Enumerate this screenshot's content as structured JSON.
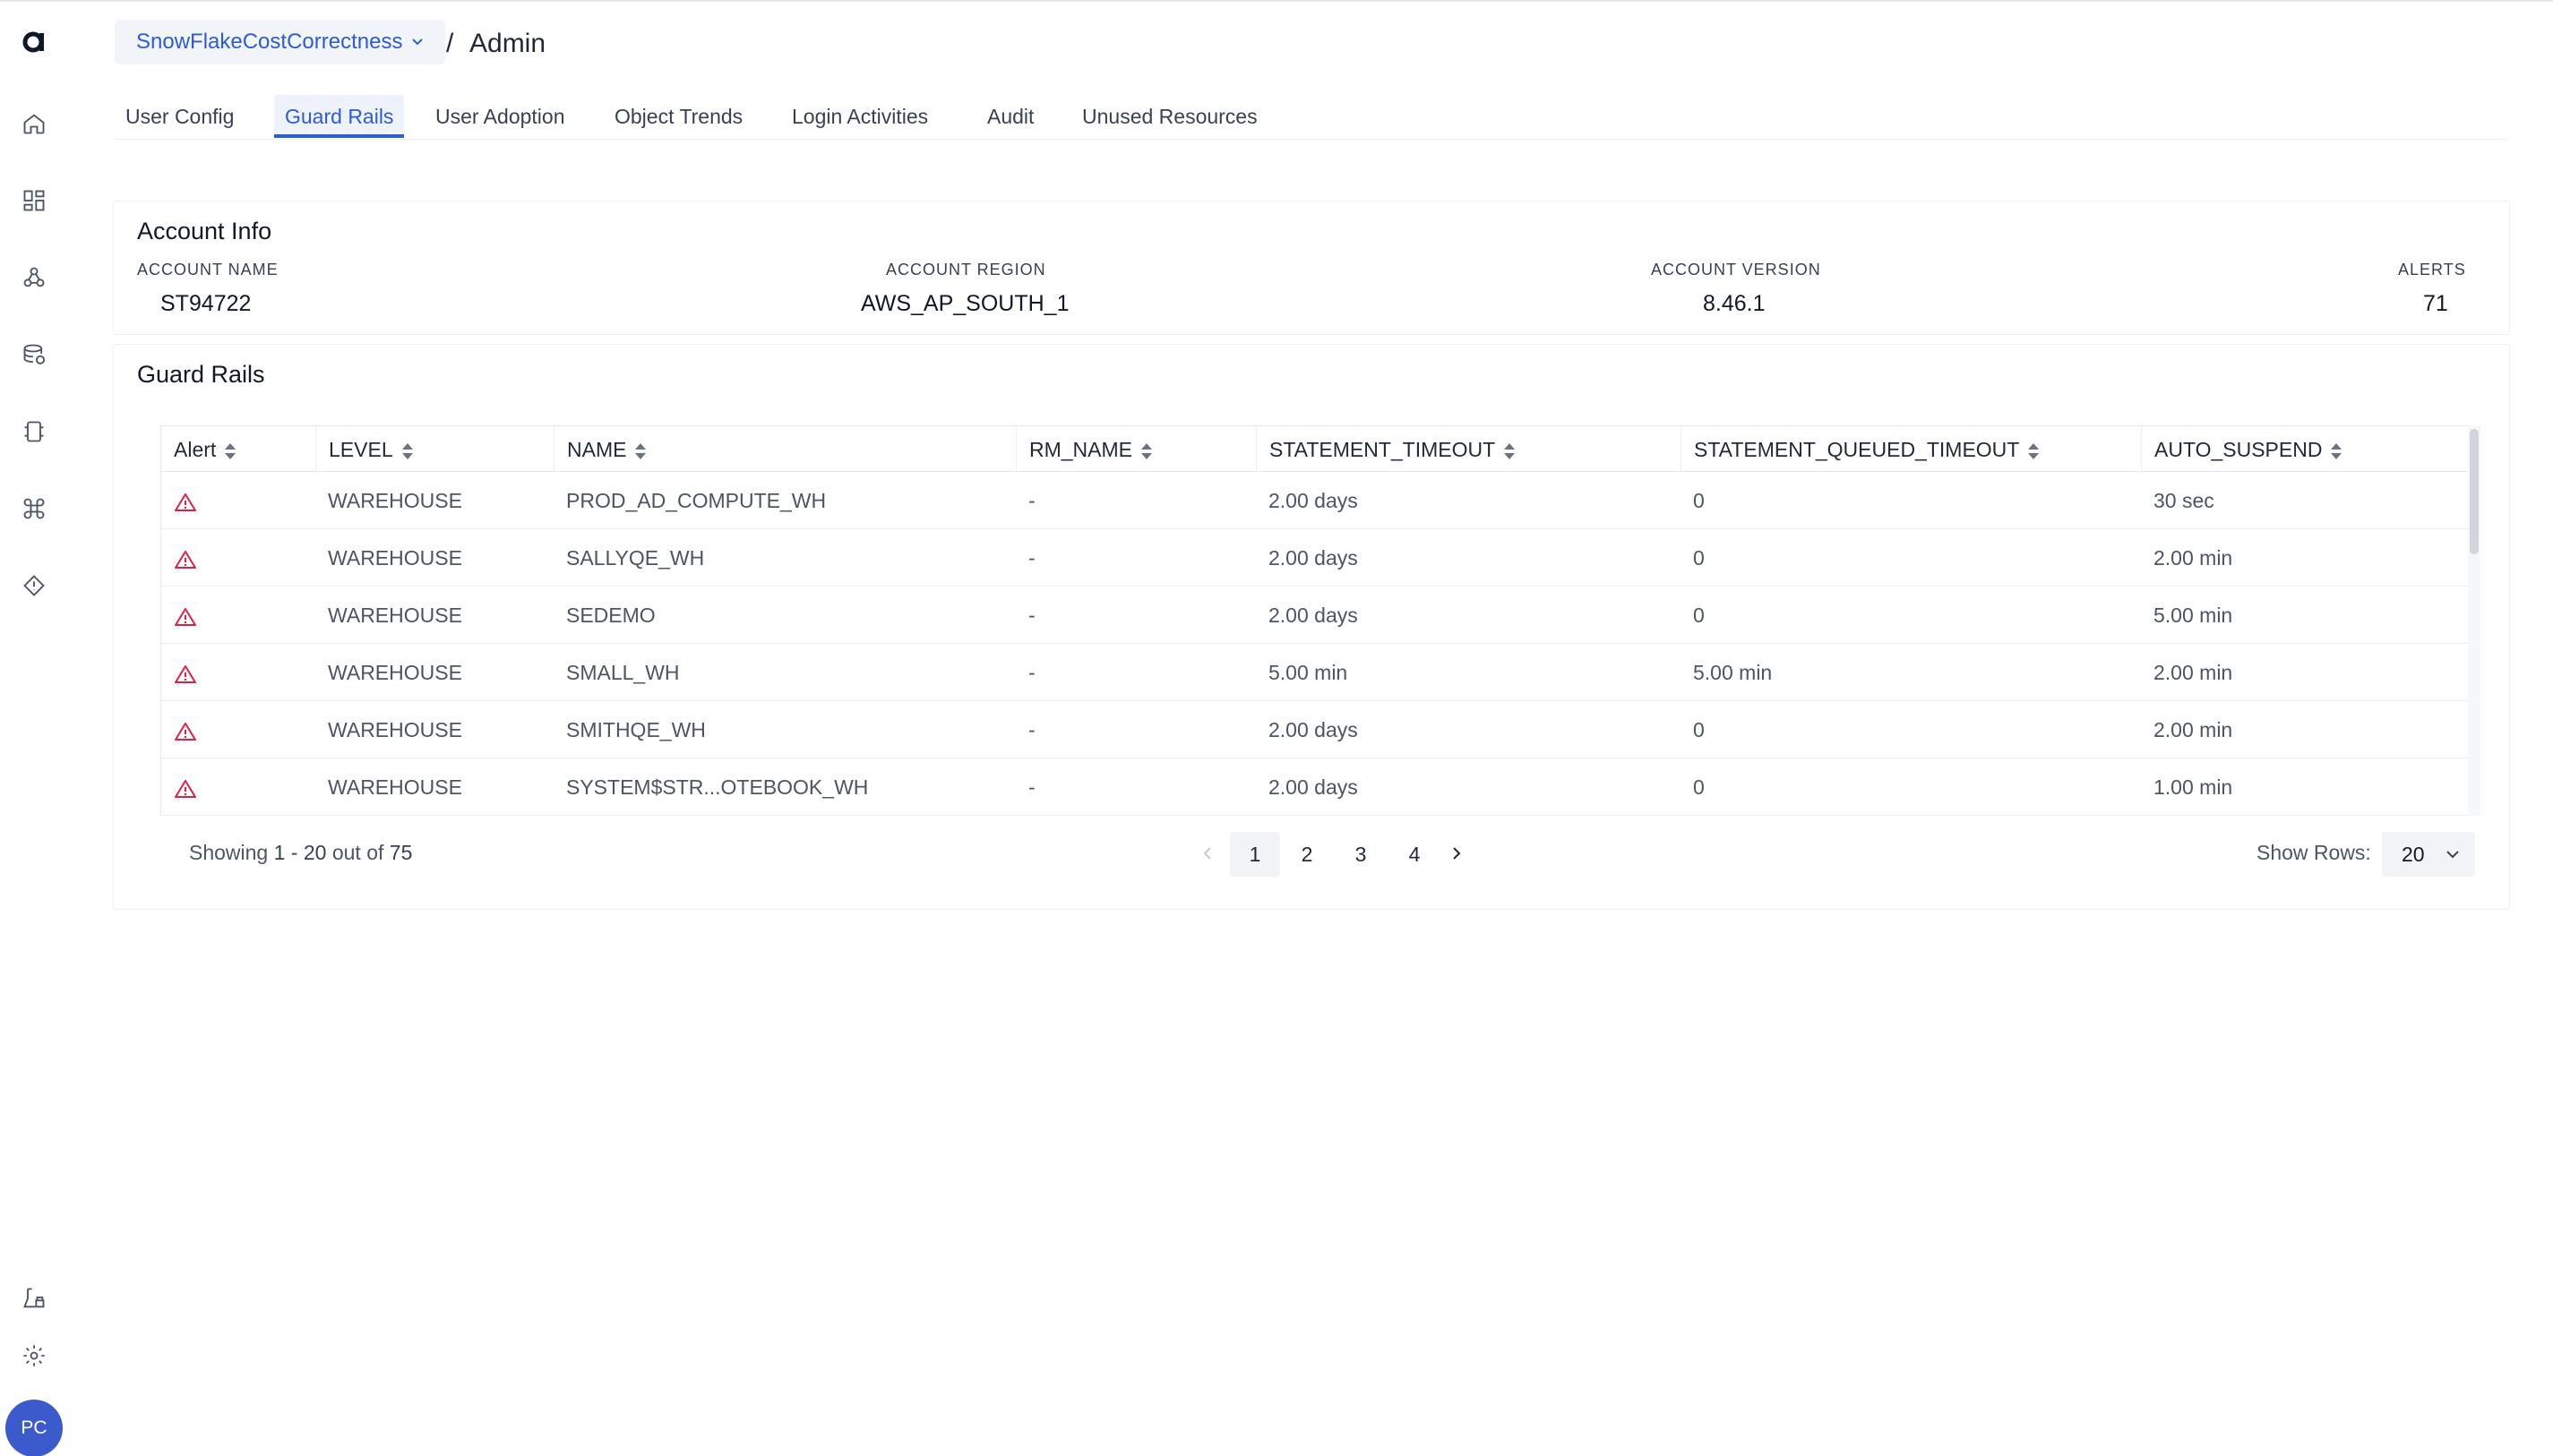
{
  "header": {
    "project": "SnowFlakeCostCorrectness",
    "separator": "/",
    "title": "Admin"
  },
  "tabs": [
    {
      "label": "User Config"
    },
    {
      "label": "Guard Rails",
      "active": true
    },
    {
      "label": "User Adoption"
    },
    {
      "label": "Object Trends"
    },
    {
      "label": "Login Activities"
    },
    {
      "label": "Audit"
    },
    {
      "label": "Unused Resources"
    }
  ],
  "account_info": {
    "title": "Account Info",
    "fields": [
      {
        "label": "ACCOUNT NAME",
        "value": "ST94722"
      },
      {
        "label": "ACCOUNT REGION",
        "value": "AWS_AP_SOUTH_1"
      },
      {
        "label": "ACCOUNT VERSION",
        "value": "8.46.1"
      },
      {
        "label": "ALERTS",
        "value": "71"
      }
    ]
  },
  "guard_rails": {
    "title": "Guard Rails",
    "columns": [
      "Alert",
      "LEVEL",
      "NAME",
      "RM_NAME",
      "STATEMENT_TIMEOUT",
      "STATEMENT_QUEUED_TIMEOUT",
      "AUTO_SUSPEND"
    ],
    "rows": [
      {
        "level": "WAREHOUSE",
        "name": "PROD_AD_COMPUTE_WH",
        "rm_name": "-",
        "statement_timeout": "2.00 days",
        "queued_timeout": "0",
        "auto_suspend": "30 sec"
      },
      {
        "level": "WAREHOUSE",
        "name": "SALLYQE_WH",
        "rm_name": "-",
        "statement_timeout": "2.00 days",
        "queued_timeout": "0",
        "auto_suspend": "2.00 min"
      },
      {
        "level": "WAREHOUSE",
        "name": "SEDEMO",
        "rm_name": "-",
        "statement_timeout": "2.00 days",
        "queued_timeout": "0",
        "auto_suspend": "5.00 min"
      },
      {
        "level": "WAREHOUSE",
        "name": "SMALL_WH",
        "rm_name": "-",
        "statement_timeout": "5.00 min",
        "queued_timeout": "5.00 min",
        "auto_suspend": "2.00 min"
      },
      {
        "level": "WAREHOUSE",
        "name": "SMITHQE_WH",
        "rm_name": "-",
        "statement_timeout": "2.00 days",
        "queued_timeout": "0",
        "auto_suspend": "2.00 min"
      },
      {
        "level": "WAREHOUSE",
        "name": "SYSTEM$STR...OTEBOOK_WH",
        "rm_name": "-",
        "statement_timeout": "2.00 days",
        "queued_timeout": "0",
        "auto_suspend": "1.00 min"
      }
    ],
    "alert_icon": "warning-triangle-icon",
    "alert_color": "#e11d48"
  },
  "pagination": {
    "showing_prefix": "Showing",
    "range": "1 - 20",
    "out_of": "out of",
    "total": "75",
    "pages": [
      "1",
      "2",
      "3",
      "4"
    ],
    "current_page": "1",
    "show_rows_label": "Show Rows:",
    "rows_per_page": "20"
  },
  "sidebar": {
    "icons": [
      "home-icon",
      "dashboard-icon",
      "cluster-icon",
      "database-icon",
      "chip-icon",
      "command-icon",
      "diamond-icon",
      "lab-icon",
      "settings-icon"
    ],
    "avatar": "PC"
  },
  "colors": {
    "accent": "#2f5bd3",
    "avatar": "#3b5bcc"
  }
}
